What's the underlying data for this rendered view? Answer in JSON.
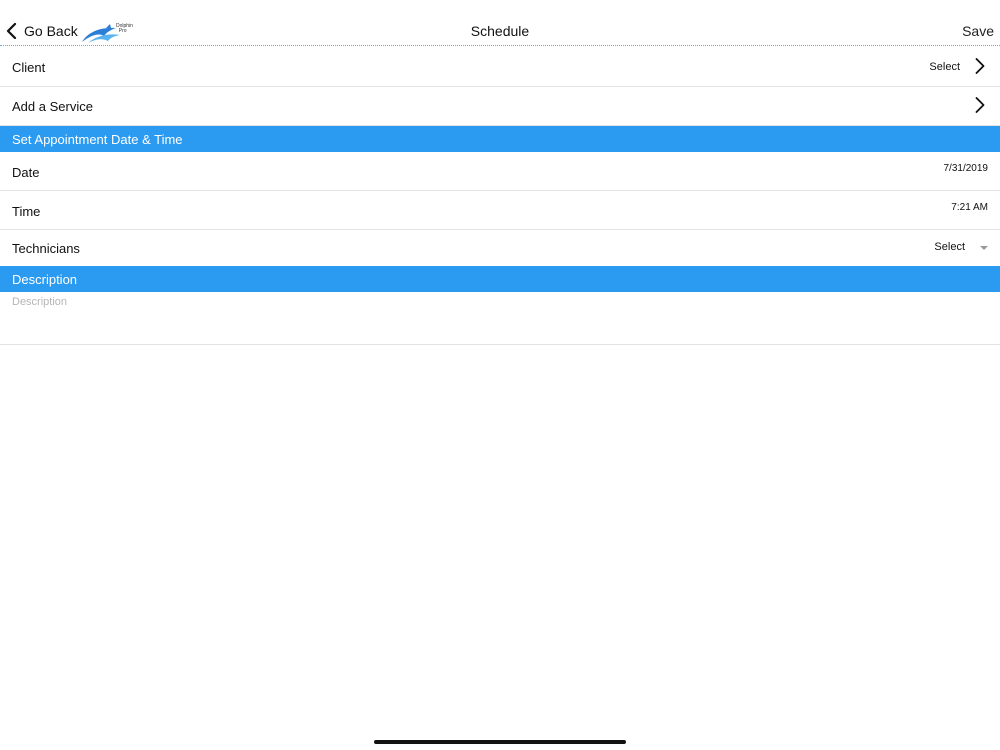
{
  "navbar": {
    "back_label": "Go Back",
    "title": "Schedule",
    "save_label": "Save",
    "logo_text": "Dolphin\n  Pro"
  },
  "rows": {
    "client": {
      "label": "Client",
      "value": "Select"
    },
    "service": {
      "label": "Add a Service"
    },
    "date": {
      "label": "Date",
      "value": "7/31/2019"
    },
    "time": {
      "label": "Time",
      "value": "7:21 AM"
    },
    "technicians": {
      "label": "Technicians",
      "value": "Select"
    }
  },
  "sections": {
    "appointment": "Set Appointment Date & Time",
    "description": "Description"
  },
  "description_field": {
    "placeholder": "Description",
    "value": ""
  },
  "colors": {
    "accent": "#2b9af1",
    "divider": "#e3e3e3",
    "placeholder": "#b5b5b5"
  }
}
